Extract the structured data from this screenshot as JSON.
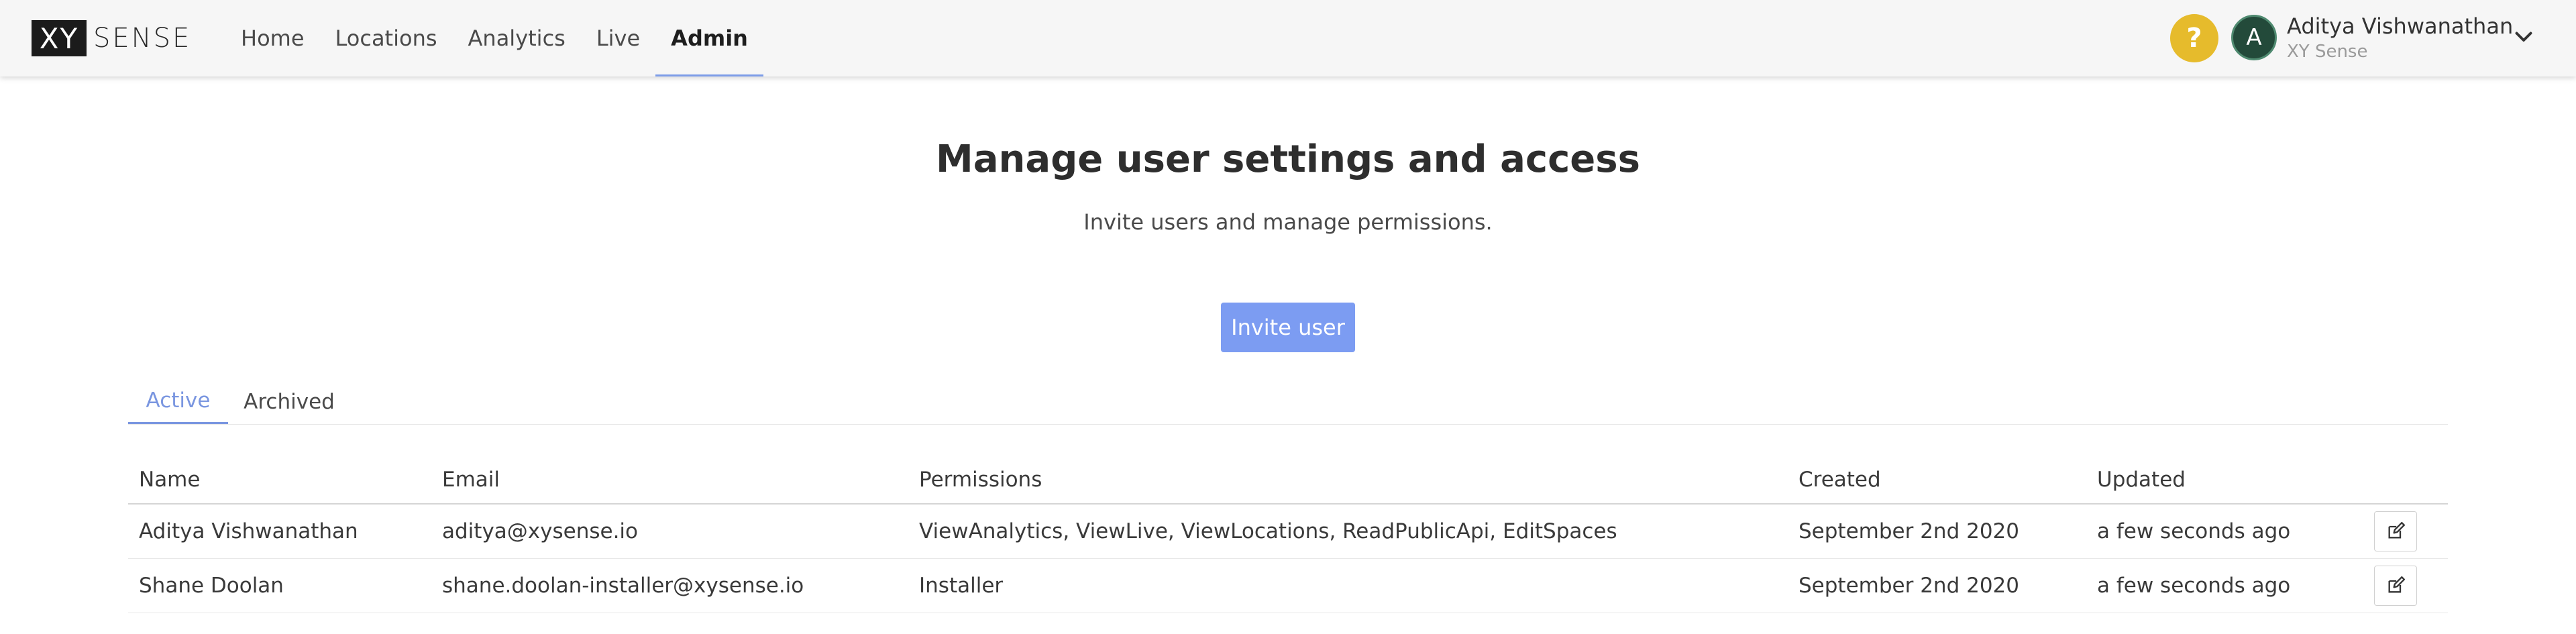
{
  "brand": {
    "logo_mark": "XY",
    "logo_text": "SENSE"
  },
  "nav": {
    "items": [
      {
        "label": "Home"
      },
      {
        "label": "Locations"
      },
      {
        "label": "Analytics"
      },
      {
        "label": "Live"
      },
      {
        "label": "Admin"
      }
    ],
    "active": "Admin"
  },
  "header": {
    "help_symbol": "?",
    "avatar_initial": "A",
    "user_name": "Aditya Vishwanathan",
    "user_org": "XY Sense"
  },
  "main": {
    "title": "Manage user settings and access",
    "subtitle": "Invite users and manage permissions.",
    "invite_label": "Invite user",
    "tabs": [
      {
        "label": "Active"
      },
      {
        "label": "Archived"
      }
    ],
    "active_tab": "Active"
  },
  "table": {
    "columns": [
      "Name",
      "Email",
      "Permissions",
      "Created",
      "Updated"
    ],
    "rows": [
      [
        "Aditya Vishwanathan",
        "aditya@xysense.io",
        "ViewAnalytics, ViewLive, ViewLocations, ReadPublicApi, EditSpaces",
        "September 2nd 2020",
        "a few seconds ago"
      ],
      [
        "Shane Doolan",
        "shane.doolan-installer@xysense.io",
        "Installer",
        "September 2nd 2020",
        "a few seconds ago"
      ]
    ]
  },
  "colors": {
    "accent": "#7c9cf2",
    "help_badge": "#e6bb2c",
    "avatar_bg": "#234a3a",
    "topbar_bg": "#f6f6f6"
  },
  "icons": {
    "help": "question-icon",
    "dropdown": "chevron-down-icon",
    "edit": "edit-icon"
  }
}
